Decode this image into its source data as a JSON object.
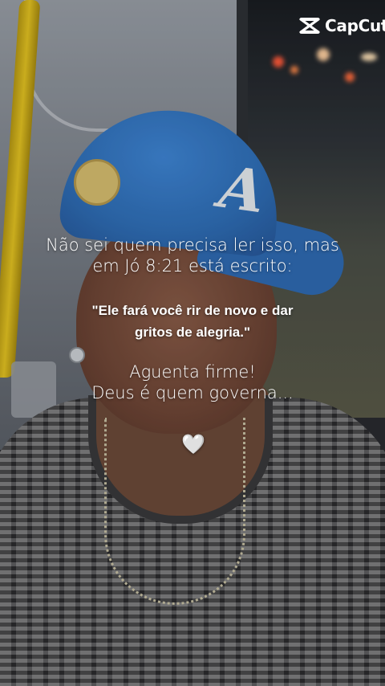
{
  "watermark": {
    "brand_name": "CapCut",
    "icon": "capcut-logo-icon"
  },
  "caption": {
    "intro_lines": [
      "Não sei quem precisa ler isso, mas",
      "em Jó 8:21 está escrito:"
    ],
    "quote_lines": [
      "\"Ele fará você rir de novo e dar",
      "gritos de alegria.\""
    ],
    "encouragement_lines": [
      "Aguenta firme!",
      "Deus é quem governa..."
    ],
    "heart_glyph": "🤍"
  },
  "colors": {
    "text": "#ffffff",
    "cap_blue": "#2f6fb8",
    "pole_yellow": "#e6c522"
  }
}
